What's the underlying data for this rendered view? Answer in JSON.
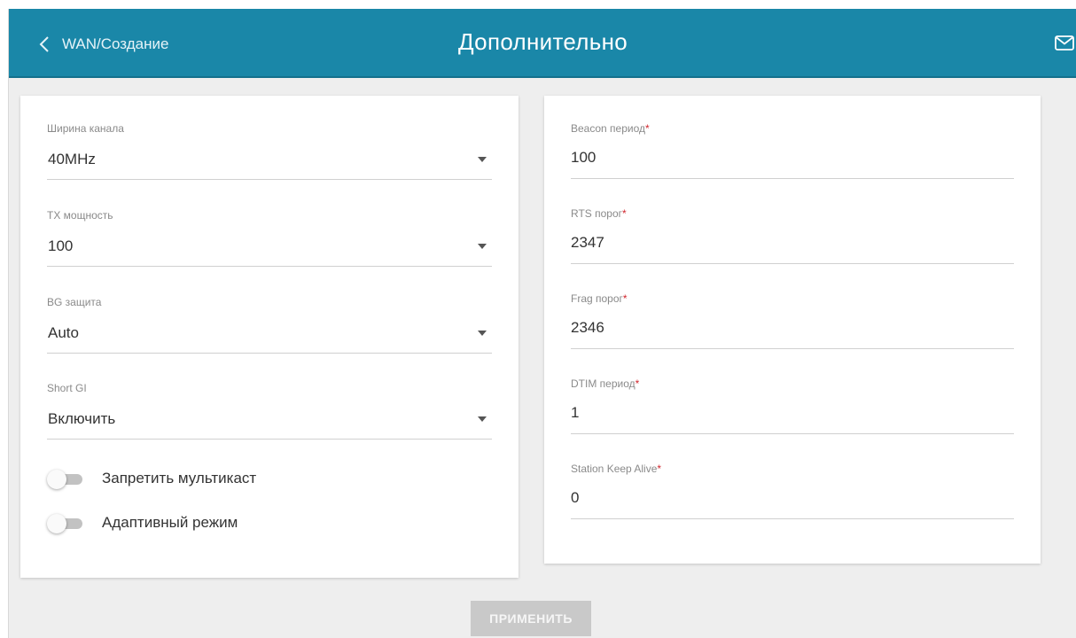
{
  "header": {
    "back_label": "WAN/Создание",
    "title": "Дополнительно"
  },
  "left_panel": {
    "channel_width": {
      "label": "Ширина канала",
      "value": "40MHz"
    },
    "tx_power": {
      "label": "TX мощность",
      "value": "100"
    },
    "bg_protection": {
      "label": "BG защита",
      "value": "Auto"
    },
    "short_gi": {
      "label": "Short GI",
      "value": "Включить"
    },
    "disable_multicast": {
      "label": "Запретить мультикаст",
      "checked": false
    },
    "adaptive_mode": {
      "label": "Адаптивный режим",
      "checked": false
    }
  },
  "right_panel": {
    "beacon_period": {
      "label": "Beacon период",
      "required_mark": "*",
      "value": "100"
    },
    "rts_threshold": {
      "label": "RTS порог",
      "required_mark": "*",
      "value": "2347"
    },
    "frag_threshold": {
      "label": "Frag порог",
      "required_mark": "*",
      "value": "2346"
    },
    "dtim_period": {
      "label": "DTIM период",
      "required_mark": "*",
      "value": "1"
    },
    "station_keep_alive": {
      "label": "Station Keep Alive",
      "required_mark": "*",
      "value": "0"
    }
  },
  "footer": {
    "apply_label": "ПРИМЕНИТЬ"
  },
  "icons": {
    "back": "chevron-left-icon",
    "mail": "mail-icon",
    "dropdown": "caret-down-icon"
  },
  "colors": {
    "header": "#1a87a8",
    "background": "#eeeeee",
    "required": "#d0262d",
    "apply_disabled": "#c9c9c9"
  }
}
